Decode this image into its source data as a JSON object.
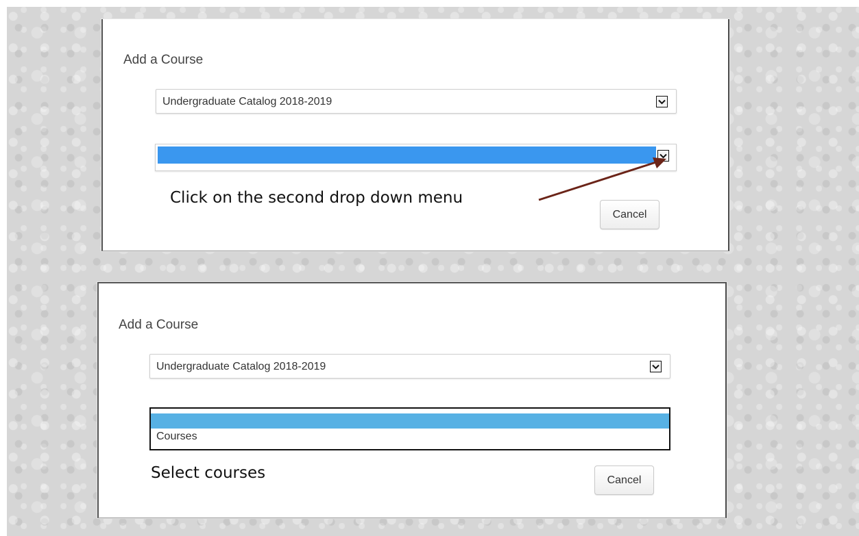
{
  "colors": {
    "highlight_blue": "#3a97ef",
    "list_highlight": "#57b1e4",
    "arrow_annotation": "#6b2418"
  },
  "step1": {
    "title": "Add a Course",
    "catalog_select_value": "Undergraduate Catalog 2018-2019",
    "second_select_value": "",
    "instruction": "Click on the second drop down menu",
    "cancel_label": "Cancel"
  },
  "step2": {
    "title": "Add a Course",
    "catalog_select_value": "Undergraduate Catalog 2018-2019",
    "dropdown_options": [
      "",
      "Courses"
    ],
    "instruction": "Select courses",
    "cancel_label": "Cancel"
  }
}
